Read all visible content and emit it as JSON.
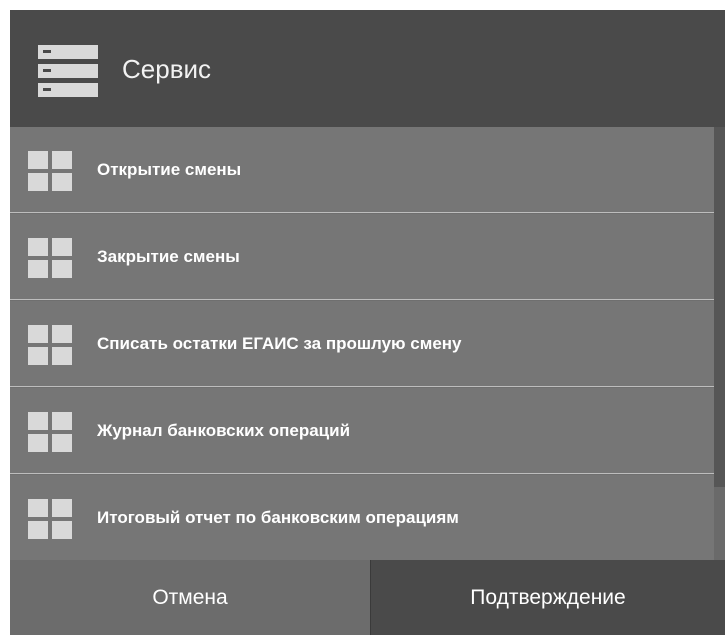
{
  "header": {
    "icon": "server-list-icon",
    "title": "Сервис"
  },
  "menu": {
    "items": [
      {
        "icon": "tiles-icon",
        "label": "Открытие смены"
      },
      {
        "icon": "tiles-icon",
        "label": "Закрытие смены"
      },
      {
        "icon": "tiles-icon",
        "label": "Списать остатки ЕГАИС за прошлую смену"
      },
      {
        "icon": "tiles-icon",
        "label": "Журнал банковских операций"
      },
      {
        "icon": "tiles-icon",
        "label": "Итоговый отчет по банковским операциям"
      }
    ]
  },
  "footer": {
    "cancel_label": "Отмена",
    "confirm_label": "Подтверждение"
  },
  "colors": {
    "header_bg": "#4a4a4a",
    "item_bg": "#767676",
    "divider": "#bdbdbd",
    "tile": "#d9d9d9",
    "cancel_bg": "#6c6c6c",
    "confirm_bg": "#4a4a4a"
  }
}
